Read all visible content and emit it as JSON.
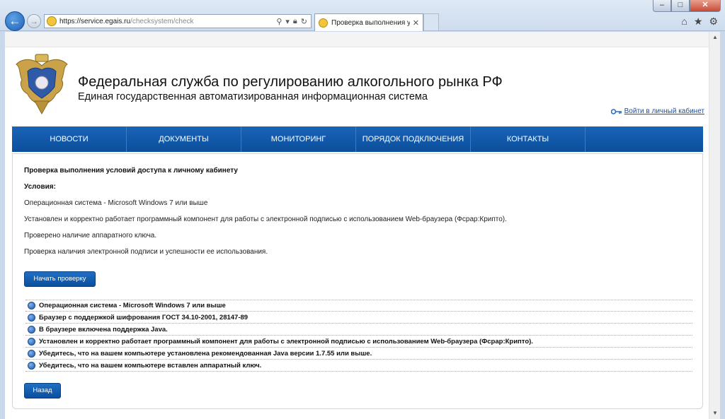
{
  "browser": {
    "url_host": "https://service.egais.ru",
    "url_path": "/checksystem/check",
    "tab_title": "Проверка выполнения усл...",
    "window_controls": {
      "minimize": "–",
      "maximize": "□",
      "close": "✕"
    },
    "icons": [
      "back-arrow-icon",
      "forward-arrow-icon",
      "search-icon",
      "lock-icon",
      "refresh-icon",
      "home-icon",
      "star-icon",
      "gear-icon"
    ]
  },
  "header": {
    "title": "Федеральная служба по регулированию алкогольного рынка РФ",
    "subtitle": "Единая государственная автоматизированная информационная система",
    "login_link": "Войти в личный кабинет"
  },
  "menu": {
    "items": [
      {
        "label": "НОВОСТИ"
      },
      {
        "label": "ДОКУМЕНТЫ"
      },
      {
        "label": "МОНИТОРИНГ"
      },
      {
        "label": "ПОРЯДОК ПОДКЛЮЧЕНИЯ"
      },
      {
        "label": "КОНТАКТЫ"
      },
      {
        "label": ""
      }
    ]
  },
  "content": {
    "title": "Проверка выполнения условий доступа к личному кабинету",
    "conditions_label": "Условия:",
    "conditions": [
      "Операционная система - Microsoft Windows 7 или выше",
      "Установлен и корректно работает программный компонент для работы с электронной подписью с использованием Web-браузера (Фсрар:Крипто).",
      "Проверено наличие аппаратного ключа.",
      "Проверка наличия электронной подписи и успешности ее использования."
    ],
    "start_button": "Начать проверку",
    "checks": [
      "Операционная система - Microsoft Windows 7 или выше",
      "Браузер с поддержкой шифрования ГОСТ 34.10-2001, 28147-89",
      "В браузере включена поддержка Java.",
      "Установлен и корректно работает программный компонент для работы с электронной подписью с использованием Web-браузера (Фсрар:Крипто).",
      "Убедитесь, что на вашем компьютере установлена рекомендованная Java версии 1.7.55 или выше.",
      "Убедитесь, что на вашем компьютере вставлен аппаратный ключ."
    ],
    "back_button": "Назад"
  },
  "colors": {
    "menu_blue": "#0d55a6",
    "button_blue": "#1560b5",
    "link_blue": "#1c4f99",
    "check_dot": "#1f59b0"
  }
}
